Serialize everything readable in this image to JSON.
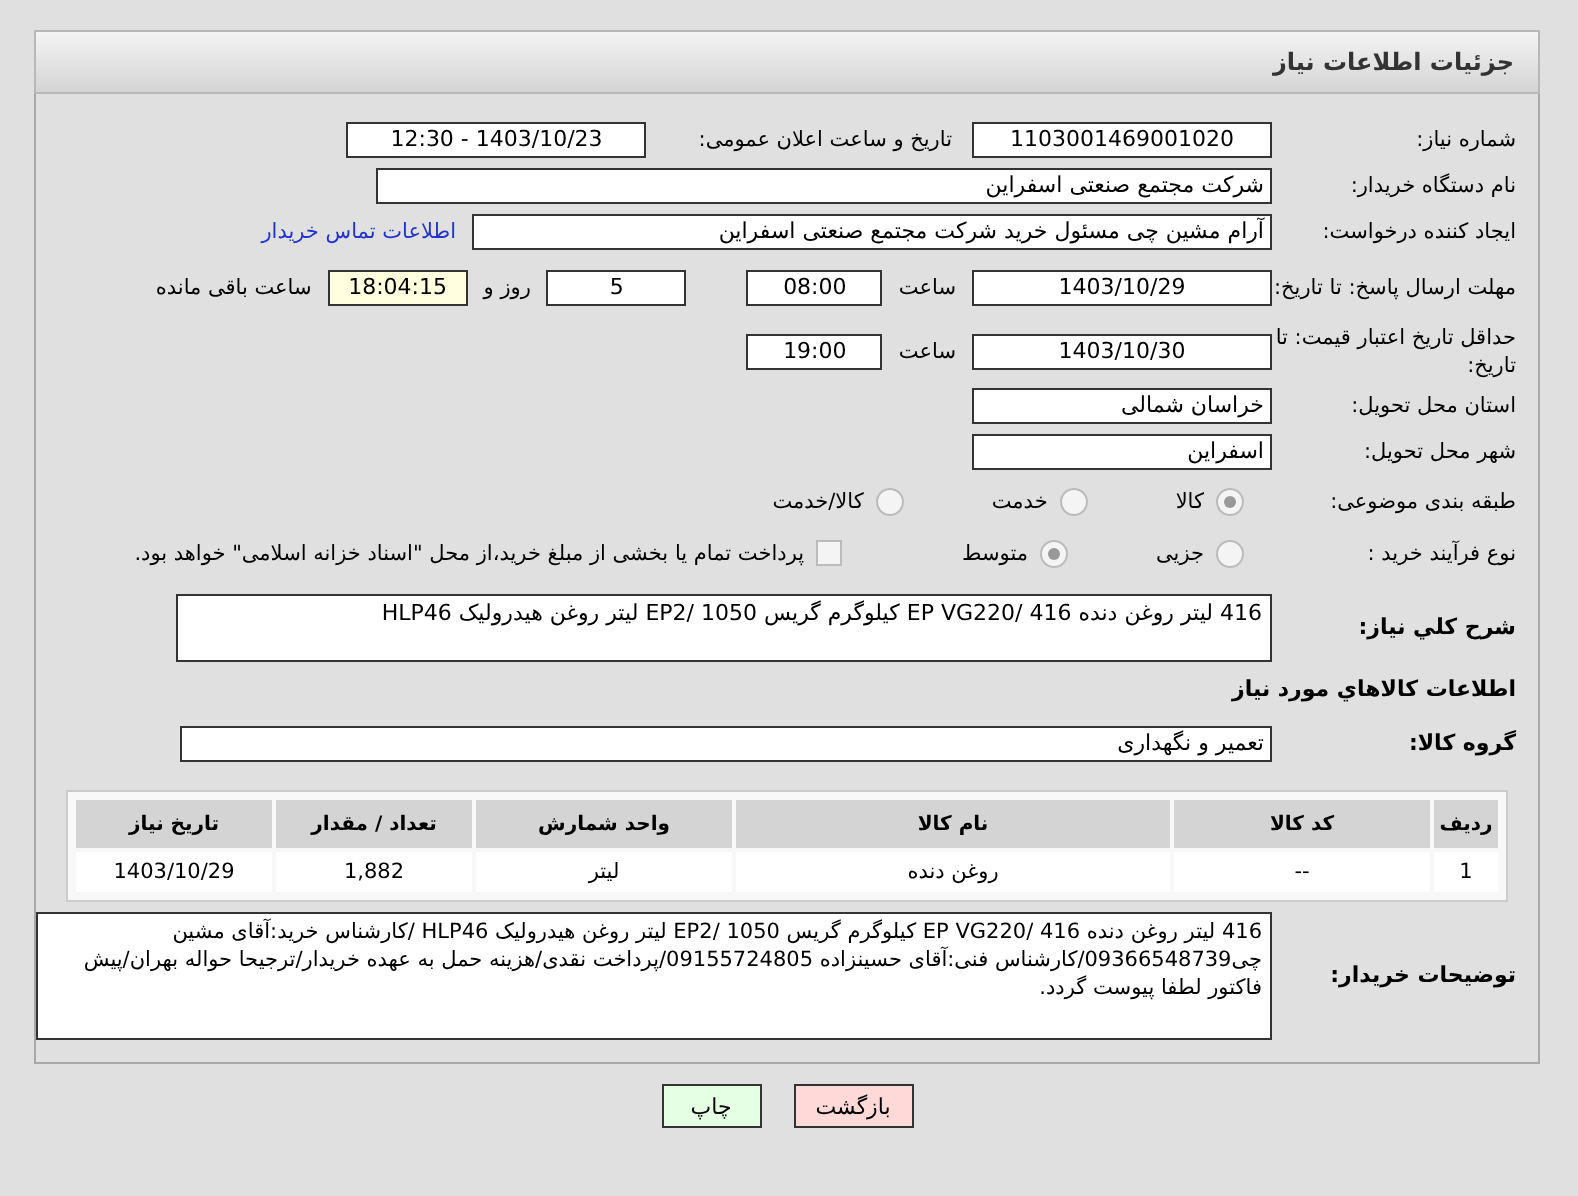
{
  "header": {
    "title": "جزئیات اطلاعات نیاز"
  },
  "fields": {
    "need_number": {
      "label": "شماره نیاز:",
      "value": "1103001469001020"
    },
    "announce": {
      "label": "تاریخ و ساعت اعلان عمومی:",
      "value": "1403/10/23 - 12:30"
    },
    "buyer": {
      "label": "نام دستگاه خریدار:",
      "value": "شرکت مجتمع صنعتی اسفراین"
    },
    "creator": {
      "label": "ایجاد کننده درخواست:",
      "value": "آرام مشین چی مسئول خرید شرکت مجتمع صنعتی اسفراین",
      "link": "اطلاعات تماس خریدار"
    },
    "deadline": {
      "label": "مهلت ارسال پاسخ: تا تاریخ:",
      "date": "1403/10/29",
      "time_label": "ساعت",
      "time": "08:00",
      "days": "5",
      "days_label": "روز و",
      "remaining": "18:04:15",
      "remaining_label": "ساعت باقی مانده"
    },
    "validity": {
      "label": "حداقل تاریخ اعتبار قیمت: تا تاریخ:",
      "date": "1403/10/30",
      "time_label": "ساعت",
      "time": "19:00"
    },
    "province": {
      "label": "استان محل تحویل:",
      "value": "خراسان شمالی"
    },
    "city": {
      "label": "شهر محل تحویل:",
      "value": "اسفراین"
    }
  },
  "category": {
    "label": "طبقه بندی موضوعی:",
    "options": [
      {
        "label": "کالا",
        "selected": true
      },
      {
        "label": "خدمت",
        "selected": false
      },
      {
        "label": "کالا/خدمت",
        "selected": false
      }
    ]
  },
  "process": {
    "label": "نوع فرآیند خرید :",
    "options": [
      {
        "label": "جزیی",
        "selected": false
      },
      {
        "label": "متوسط",
        "selected": true
      }
    ],
    "treasury": {
      "checked": false,
      "text": "پرداخت تمام یا بخشی از مبلغ خرید،از محل \"اسناد خزانه اسلامی\" خواهد بود."
    }
  },
  "description": {
    "label": "شرح کلي نياز:",
    "value": "416 لیتر روغن دنده 416 /EP VG220 کیلوگرم گریس 1050 /EP2 لیتر روغن هیدرولیک HLP46"
  },
  "goods_title": "اطلاعات کالاهاي مورد نياز",
  "goods_group": {
    "label": "گروه کالا:",
    "value": "تعمیر و نگهداری"
  },
  "table": {
    "columns": [
      "رديف",
      "کد کالا",
      "نام کالا",
      "واحد شمارش",
      "تعداد / مقدار",
      "تاریخ نیاز"
    ],
    "rows": [
      [
        "1",
        "--",
        "روغن دنده",
        "لیتر",
        "1,882",
        "1403/10/29"
      ]
    ]
  },
  "buyer_notes": {
    "label": "توضیحات خریدار:",
    "value": "416 لیتر روغن دنده 416 /EP VG220 کیلوگرم گریس 1050 /EP2 لیتر روغن هیدرولیک HLP46 /کارشناس خرید:آقای مشین چی09366548739/کارشناس فنی:آقای حسینزاده 09155724805/پرداخت نقدی/هزینه حمل به عهده خریدار/ترجیحا حواله بهران/پیش فاکتور لطفا پیوست گردد."
  },
  "buttons": [
    {
      "label": "بازگشت",
      "kind": "back"
    },
    {
      "label": "چاپ",
      "kind": "print"
    }
  ]
}
